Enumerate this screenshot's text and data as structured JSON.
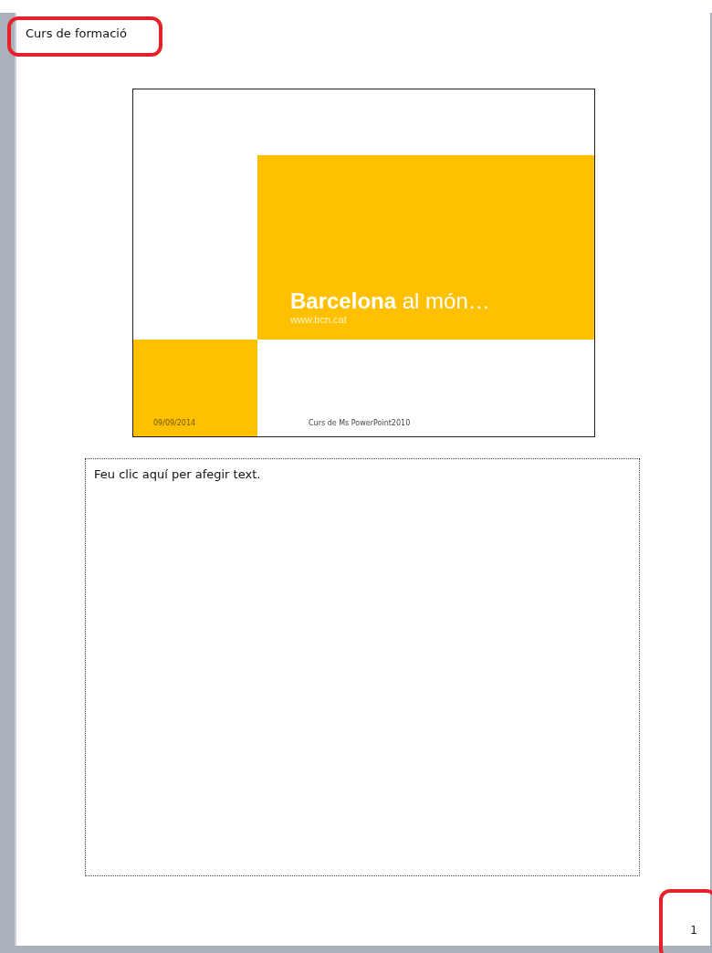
{
  "header": {
    "text": "Curs de formació",
    "highlighted": true
  },
  "slide": {
    "title_bold": "Barcelona",
    "title_rest": "al món…",
    "subtitle": "www.bcn.cat",
    "date": "09/09/2014",
    "footer": "Curs de Ms PowerPoint2010"
  },
  "notes": {
    "placeholder": "Feu clic aquí per afegir text."
  },
  "page_number": {
    "text": "1",
    "highlighted": true
  }
}
